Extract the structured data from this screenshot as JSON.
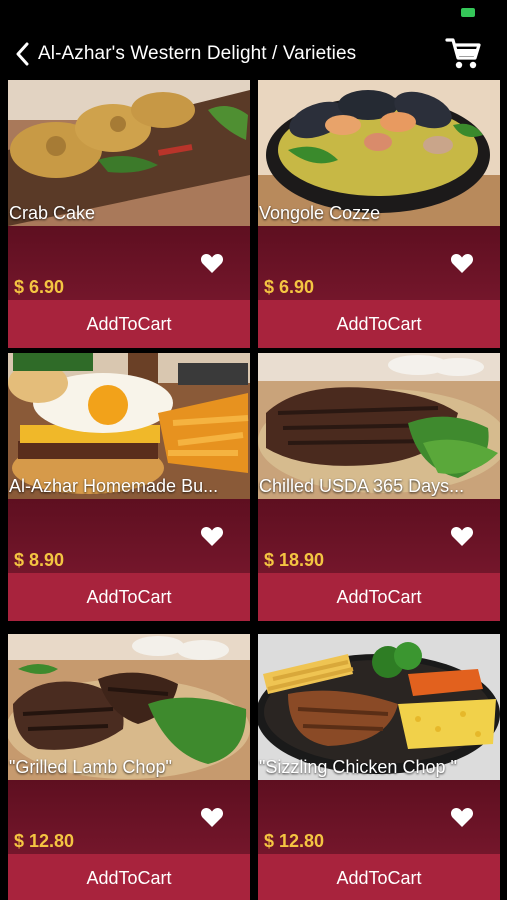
{
  "colors": {
    "card_bg": "#6b1226",
    "button_bg": "#a8233d",
    "price": "#f4c542",
    "battery": "#35c759"
  },
  "header": {
    "title": "Al-Azhar's Western Delight / Varieties",
    "back_icon": "chevron-left-icon",
    "cart_icon": "shopping-cart-icon"
  },
  "products": [
    {
      "name": "Crab Cake",
      "price": "$ 6.90",
      "button": "AddToCart",
      "image": "crab-cake-photo"
    },
    {
      "name": "Vongole Cozze",
      "price": "$ 6.90",
      "button": "AddToCart",
      "image": "vongole-cozze-photo"
    },
    {
      "name": "Al-Azhar Homemade Bu...",
      "price": "$ 8.90",
      "button": "AddToCart",
      "image": "burger-photo"
    },
    {
      "name": "Chilled USDA 365 Days...",
      "price": "$ 18.90",
      "button": "AddToCart",
      "image": "steak-photo"
    },
    {
      "name": "\"Grilled Lamb Chop\"",
      "price": "$ 12.80",
      "button": "AddToCart",
      "image": "lamb-chop-photo"
    },
    {
      "name": "\"Sizzling Chicken Chop \"",
      "price": "$ 12.80",
      "button": "AddToCart",
      "image": "chicken-chop-photo"
    }
  ]
}
